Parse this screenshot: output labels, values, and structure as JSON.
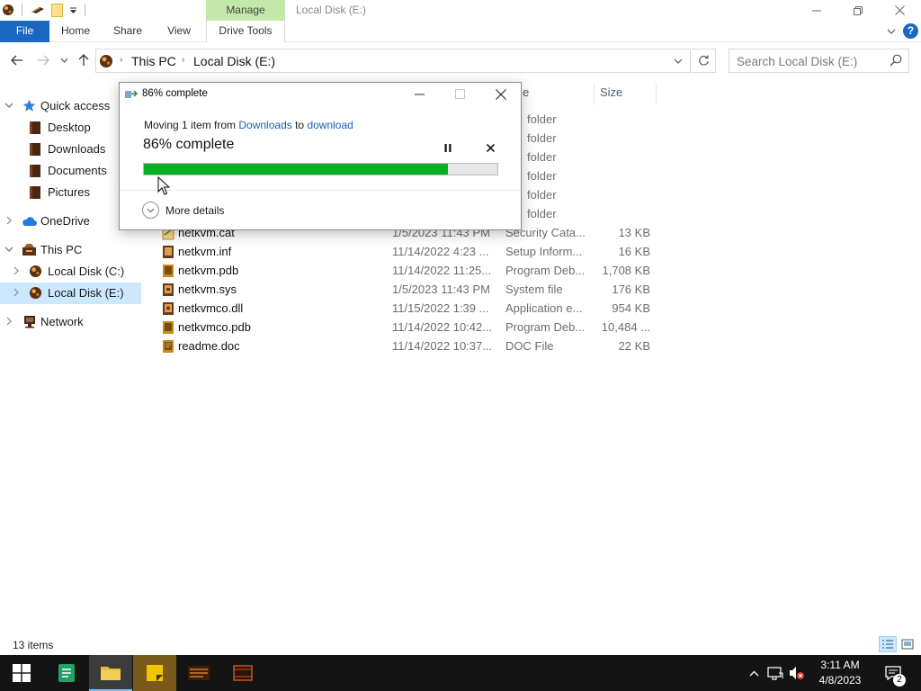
{
  "window": {
    "title": "Local Disk (E:)",
    "context_tab": "Manage"
  },
  "ribbon": {
    "tabs": [
      "File",
      "Home",
      "Share",
      "View",
      "Drive Tools"
    ],
    "help_label": "?"
  },
  "address": {
    "crumbs": [
      "This PC",
      "Local Disk (E:)"
    ]
  },
  "search": {
    "placeholder": "Search Local Disk (E:)"
  },
  "nav_pane": {
    "quick_access": "Quick access",
    "desktop": "Desktop",
    "downloads": "Downloads",
    "documents": "Documents",
    "pictures": "Pictures",
    "onedrive": "OneDrive",
    "this_pc": "This PC",
    "local_c": "Local Disk (C:)",
    "local_e": "Local Disk (E:)",
    "network": "Network"
  },
  "file_list": {
    "columns": {
      "type_partial": "e",
      "size": "Size"
    },
    "partial_folder_label": "folder",
    "partial_folder_count": 6,
    "rows": [
      {
        "name": "netkvm.cat",
        "date": "1/5/2023 11:43 PM",
        "type": "Security Cata...",
        "size": "13 KB",
        "icon": "catalog-file-icon"
      },
      {
        "name": "netkvm.inf",
        "date": "11/14/2022 4:23 ...",
        "type": "Setup Inform...",
        "size": "16 KB",
        "icon": "inf-file-icon"
      },
      {
        "name": "netkvm.pdb",
        "date": "11/14/2022 11:25...",
        "type": "Program Deb...",
        "size": "1,708 KB",
        "icon": "pdb-file-icon"
      },
      {
        "name": "netkvm.sys",
        "date": "1/5/2023 11:43 PM",
        "type": "System file",
        "size": "176 KB",
        "icon": "sys-file-icon"
      },
      {
        "name": "netkvmco.dll",
        "date": "11/15/2022 1:39 ...",
        "type": "Application e...",
        "size": "954 KB",
        "icon": "dll-file-icon"
      },
      {
        "name": "netkvmco.pdb",
        "date": "11/14/2022 10:42...",
        "type": "Program Deb...",
        "size": "10,484 ...",
        "icon": "pdb-file-icon"
      },
      {
        "name": "readme.doc",
        "date": "11/14/2022 10:37...",
        "type": "DOC File",
        "size": "22 KB",
        "icon": "doc-file-icon"
      }
    ]
  },
  "status_bar": {
    "item_count": "13 items"
  },
  "progress_dialog": {
    "title": "86% complete",
    "moving_prefix": "Moving 1 item from ",
    "source": "Downloads",
    "moving_mid": " to ",
    "destination": "download",
    "percent_text": "86% complete",
    "progress": 0.86,
    "more_details": "More details"
  },
  "taskbar": {
    "time": "3:11 AM",
    "date": "4/8/2023",
    "notification_count": "2"
  },
  "colors": {
    "accent": "#1a66c1",
    "progress_green": "#06b025",
    "manage_tab": "#c4e8a9",
    "selection": "#cce8ff"
  }
}
